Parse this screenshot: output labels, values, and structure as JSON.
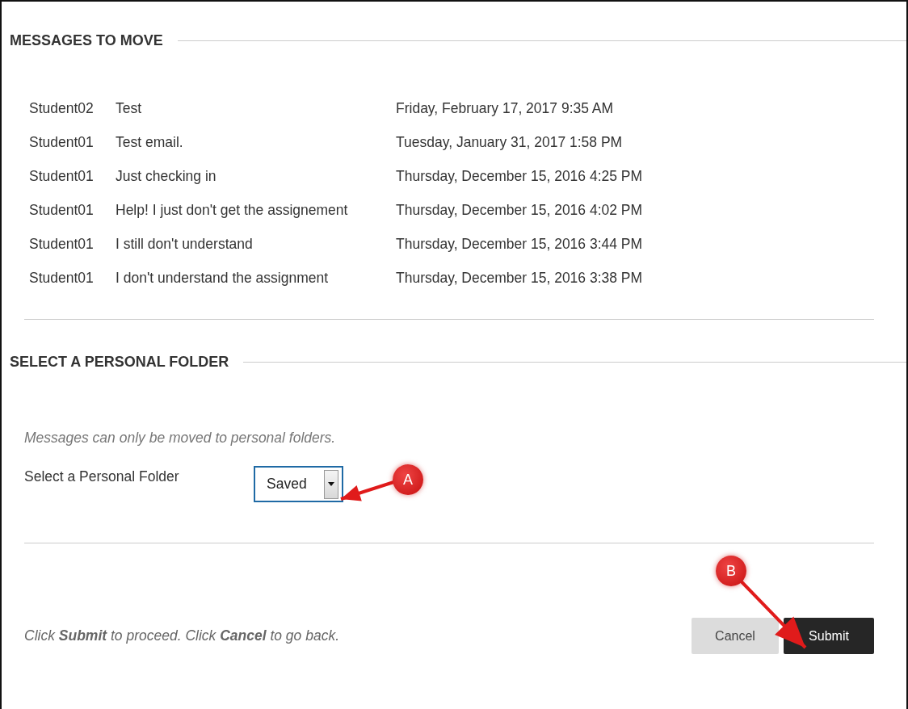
{
  "messages_section": {
    "heading": "MESSAGES TO MOVE",
    "messages": [
      {
        "sender": "Student02",
        "subject": "Test",
        "date": "Friday, February 17, 2017 9:35 AM"
      },
      {
        "sender": "Student01",
        "subject": "Test email.",
        "date": "Tuesday, January 31, 2017 1:58 PM"
      },
      {
        "sender": "Student01",
        "subject": "Just checking in",
        "date": "Thursday, December 15, 2016 4:25 PM"
      },
      {
        "sender": "Student01",
        "subject": "Help! I just don't get the assignement",
        "date": "Thursday, December 15, 2016 4:02 PM"
      },
      {
        "sender": "Student01",
        "subject": "I still don't understand",
        "date": "Thursday, December 15, 2016 3:44 PM"
      },
      {
        "sender": "Student01",
        "subject": "I don't understand the assignment",
        "date": "Thursday, December 15, 2016 3:38 PM"
      }
    ]
  },
  "folder_section": {
    "heading": "SELECT A PERSONAL FOLDER",
    "note": "Messages can only be moved to personal folders.",
    "field_label": "Select a Personal Folder",
    "select_value": "Saved"
  },
  "footer": {
    "instruction": "Click **Submit** to proceed. Click **Cancel** to go back.",
    "buttons": [
      {
        "label": "Cancel",
        "kind": "secondary"
      },
      {
        "label": "Submit",
        "kind": "primary"
      }
    ]
  },
  "callouts": [
    {
      "label": "A"
    },
    {
      "label": "B"
    }
  ]
}
